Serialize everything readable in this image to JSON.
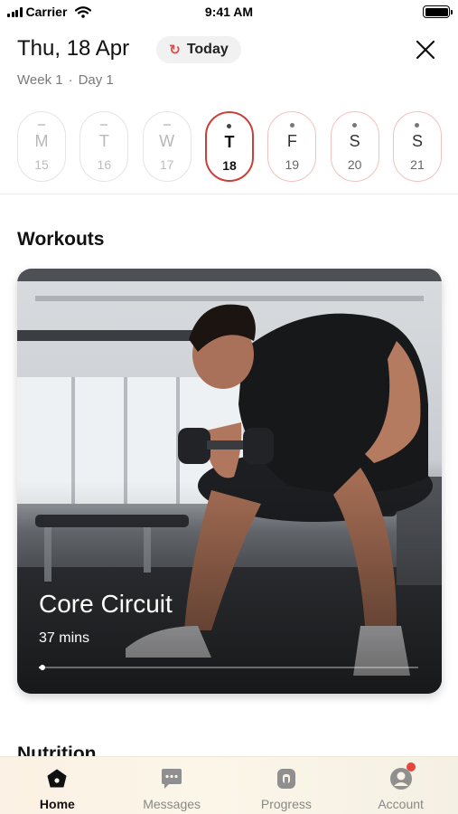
{
  "status_bar": {
    "carrier": "Carrier",
    "time": "9:41 AM"
  },
  "header": {
    "date": "Thu, 18 Apr",
    "today_label": "Today",
    "week": "Week 1",
    "separator": "·",
    "day": "Day 1"
  },
  "days": [
    {
      "letter": "M",
      "number": "15",
      "state": "past"
    },
    {
      "letter": "T",
      "number": "16",
      "state": "past"
    },
    {
      "letter": "W",
      "number": "17",
      "state": "past"
    },
    {
      "letter": "T",
      "number": "18",
      "state": "selected"
    },
    {
      "letter": "F",
      "number": "19",
      "state": "future"
    },
    {
      "letter": "S",
      "number": "20",
      "state": "future"
    },
    {
      "letter": "S",
      "number": "21",
      "state": "future"
    }
  ],
  "workouts": {
    "title": "Workouts",
    "card": {
      "name": "Core Circuit",
      "duration": "37 mins",
      "progress": 0.01
    }
  },
  "nutrition": {
    "title": "Nutrition"
  },
  "tabs": [
    {
      "label": "Home",
      "icon": "home-icon",
      "active": true
    },
    {
      "label": "Messages",
      "icon": "messages-icon",
      "active": false
    },
    {
      "label": "Progress",
      "icon": "progress-icon",
      "active": false
    },
    {
      "label": "Account",
      "icon": "account-icon",
      "active": false,
      "badge": true
    }
  ],
  "colors": {
    "accent": "#c7413a",
    "badge": "#e8463c",
    "tab_bar": "#fbf4e6"
  }
}
